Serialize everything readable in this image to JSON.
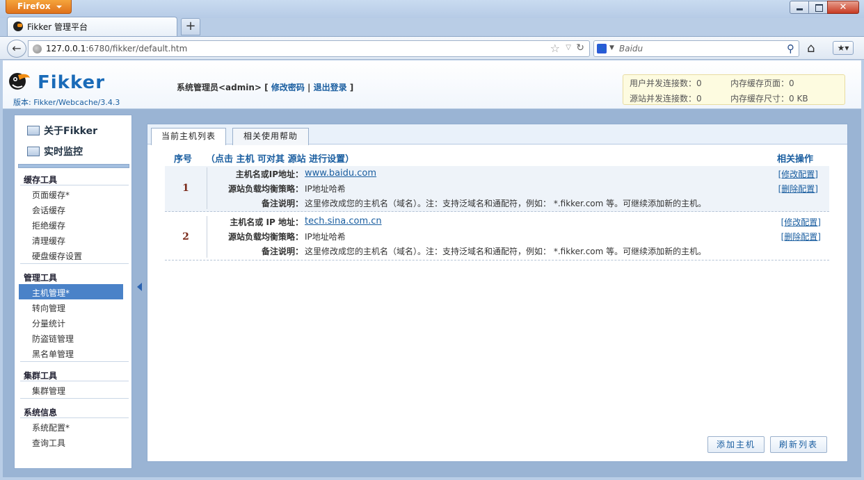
{
  "browser": {
    "app_button": "Firefox",
    "tab_title": "Fikker 管理平台",
    "url_host": "127.0.0.1",
    "url_rest": ":6780/fikker/default.htm",
    "search_placeholder": "Baidu"
  },
  "header": {
    "logo": "Fikker",
    "version": "版本: Fikker/Webcache/3.4.3",
    "admin_prefix": "系统管理员<admin> [",
    "change_password": "修改密码",
    "sep": "|",
    "logout": "退出登录",
    "admin_suffix": "]",
    "stats": {
      "user_conn": "用户并发连接数：0",
      "mem_pages": "内存缓存页面：0",
      "origin_conn": "源站并发连接数：0",
      "mem_size": "内存缓存尺寸：0 KB"
    }
  },
  "sidebar": {
    "top": [
      {
        "label": "关于Fikker"
      },
      {
        "label": "实时监控"
      }
    ],
    "groups": [
      {
        "title": "缓存工具",
        "items": [
          "页面缓存*",
          "会话缓存",
          "拒绝缓存",
          "清理缓存",
          "硬盘缓存设置"
        ]
      },
      {
        "title": "管理工具",
        "items": [
          "主机管理*",
          "转向管理",
          "分量统计",
          "防盗链管理",
          "黑名单管理"
        ]
      },
      {
        "title": "集群工具",
        "items": [
          "集群管理"
        ]
      },
      {
        "title": "系统信息",
        "items": [
          "系统配置*",
          "查询工具"
        ]
      }
    ]
  },
  "panel": {
    "tabs": [
      "当前主机列表",
      "相关使用帮助"
    ],
    "col_num": "序号",
    "col_hint": "（点击 主机 可对其 源站 进行设置）",
    "col_ops": "相关操作",
    "rows": [
      {
        "num": "1",
        "host_label": "主机名或IP地址：",
        "host": "www.baidu.com",
        "lb_label": "源站负载均衡策略：",
        "lb": "IP地址哈希",
        "note_label": "备注说明：",
        "note": "这里修改成您的主机名（域名）。注：支持泛域名和通配符，例如： *.fikker.com 等。可继续添加新的主机。",
        "edit": "[修改配置]",
        "delete": "[删除配置]"
      },
      {
        "num": "2",
        "host_label": "主机名或 IP 地址：",
        "host": "tech.sina.com.cn",
        "lb_label": "源站负载均衡策略：",
        "lb": "IP地址哈希",
        "note_label": "备注说明：",
        "note": "这里修改成您的主机名（域名）。注：支持泛域名和通配符，例如： *.fikker.com 等。可继续添加新的主机。",
        "edit": "[修改配置]",
        "delete": "[删除配置]"
      }
    ],
    "btn_add": "添加主机",
    "btn_refresh": "刷新列表"
  }
}
